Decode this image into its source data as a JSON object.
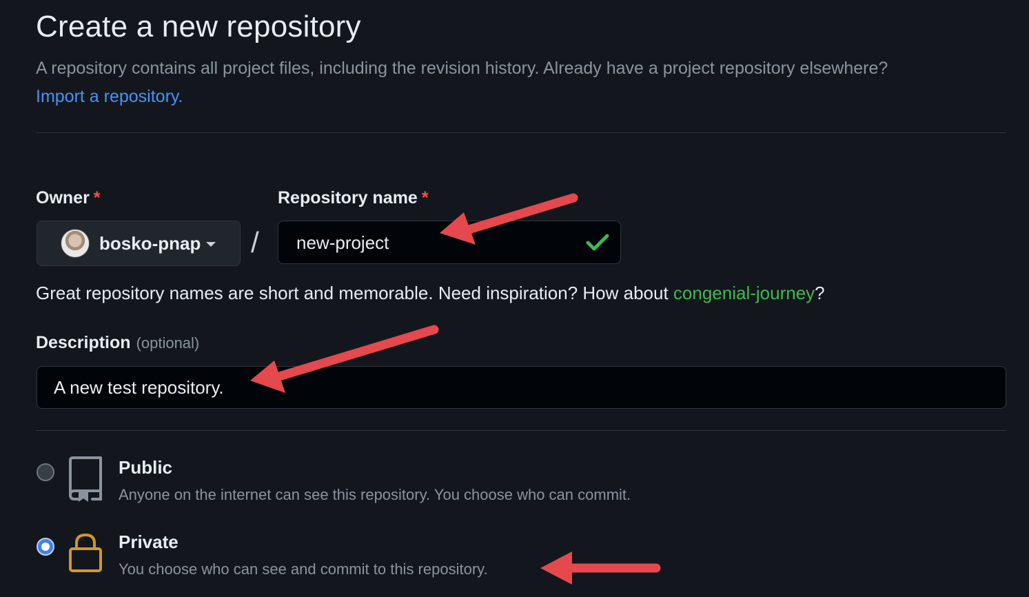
{
  "header": {
    "title": "Create a new repository",
    "subtitle": "A repository contains all project files, including the revision history. Already have a project repository elsewhere?",
    "import_link": "Import a repository."
  },
  "owner": {
    "label": "Owner",
    "required_mark": "*",
    "selected": "bosko-pnap"
  },
  "separator": "/",
  "repo_name": {
    "label": "Repository name",
    "required_mark": "*",
    "value": "new-project",
    "valid": true
  },
  "hint": {
    "prefix": "Great repository names are short and memorable. Need inspiration? How about ",
    "suggestion": "congenial-journey",
    "suffix": "?"
  },
  "description": {
    "label": "Description",
    "optional": "(optional)",
    "value": "A new test repository."
  },
  "visibility": {
    "options": [
      {
        "title": "Public",
        "description": "Anyone on the internet can see this repository. You choose who can commit.",
        "icon": "repo-icon",
        "checked": false
      },
      {
        "title": "Private",
        "description": "You choose who can see and commit to this repository.",
        "icon": "lock-icon",
        "checked": true
      }
    ]
  },
  "colors": {
    "background": "#13171d",
    "link": "#4493f8",
    "success": "#3fb950",
    "required": "#f85149",
    "annotation_arrow": "#e5484d",
    "lock_icon": "#d29922"
  }
}
